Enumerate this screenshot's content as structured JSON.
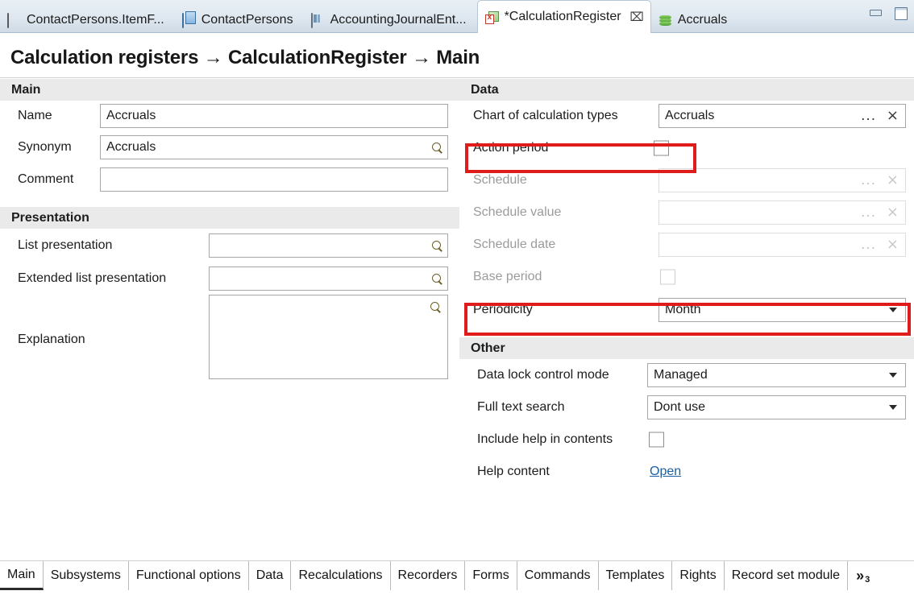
{
  "window": {
    "minimize_label": "Minimize",
    "maximize_label": "Maximize"
  },
  "editor_tabs": [
    {
      "label": "ContactPersons.ItemF...",
      "icon": "document-lines-icon",
      "active": false,
      "closable": false
    },
    {
      "label": "ContactPersons",
      "icon": "catalog-book-icon",
      "active": false,
      "closable": false
    },
    {
      "label": "AccountingJournalEnt...",
      "icon": "accounting-journal-icon",
      "active": false,
      "closable": false
    },
    {
      "label": "*CalculationRegister",
      "icon": "calculation-register-icon",
      "active": true,
      "closable": true,
      "close_glyph": "⌧"
    },
    {
      "label": "Accruals",
      "icon": "accruals-stack-icon",
      "active": false,
      "closable": false
    }
  ],
  "breadcrumb": {
    "text": "Calculation registers → CalculationRegister → Main",
    "parts": [
      "Calculation registers",
      "CalculationRegister",
      "Main"
    ],
    "separator": "→"
  },
  "left": {
    "main_section": {
      "header": "Main",
      "fields": [
        {
          "label": "Name",
          "value": "Accruals",
          "type": "text",
          "has_search": false,
          "disabled": false
        },
        {
          "label": "Synonym",
          "value": "Accruals",
          "type": "text-search",
          "has_search": true,
          "disabled": false
        },
        {
          "label": "Comment",
          "value": "",
          "type": "text",
          "has_search": false,
          "disabled": false
        }
      ]
    },
    "presentation_section": {
      "header": "Presentation",
      "fields": [
        {
          "label": "List presentation",
          "value": "",
          "type": "text-search",
          "has_search": true,
          "disabled": false
        },
        {
          "label": "Extended list presentation",
          "value": "",
          "type": "text-search",
          "has_search": true,
          "disabled": false
        },
        {
          "label": "Explanation",
          "value": "",
          "type": "textarea-search",
          "has_search": true,
          "disabled": false
        }
      ]
    }
  },
  "right": {
    "data_section": {
      "header": "Data",
      "fields": [
        {
          "label": "Chart of calculation types",
          "value": "Accruals",
          "type": "picker",
          "disabled": false,
          "ellipsis": "...",
          "clear": "×",
          "highlighted": false
        },
        {
          "label": "Action period",
          "value": "",
          "type": "checkbox",
          "checked": false,
          "disabled": false,
          "highlighted": true
        },
        {
          "label": "Schedule",
          "value": "",
          "type": "picker",
          "disabled": true,
          "ellipsis": "...",
          "clear": "×",
          "highlighted": false
        },
        {
          "label": "Schedule value",
          "value": "",
          "type": "picker",
          "disabled": true,
          "ellipsis": "...",
          "clear": "×",
          "highlighted": false
        },
        {
          "label": "Schedule date",
          "value": "",
          "type": "picker",
          "disabled": true,
          "ellipsis": "...",
          "clear": "×",
          "highlighted": false
        },
        {
          "label": "Base period",
          "value": "",
          "type": "checkbox",
          "checked": false,
          "disabled": true,
          "highlighted": false
        },
        {
          "label": "Periodicity",
          "value": "Month",
          "type": "combo",
          "disabled": false,
          "highlighted": true
        }
      ]
    },
    "other_section": {
      "header": "Other",
      "fields": [
        {
          "label": "Data lock control mode",
          "value": "Managed",
          "type": "combo",
          "disabled": false
        },
        {
          "label": "Full text search",
          "value": "Dont use",
          "type": "combo",
          "disabled": false
        },
        {
          "label": "Include help in contents",
          "value": "",
          "type": "checkbox",
          "checked": false,
          "disabled": false
        },
        {
          "label": "Help content",
          "value": "Open",
          "type": "link",
          "disabled": false
        }
      ]
    }
  },
  "bottom_tabs": [
    {
      "label": "Main",
      "active": true
    },
    {
      "label": "Subsystems",
      "active": false
    },
    {
      "label": "Functional options",
      "active": false
    },
    {
      "label": "Data",
      "active": false
    },
    {
      "label": "Recalculations",
      "active": false
    },
    {
      "label": "Recorders",
      "active": false
    },
    {
      "label": "Forms",
      "active": false
    },
    {
      "label": "Commands",
      "active": false
    },
    {
      "label": "Templates",
      "active": false
    },
    {
      "label": "Rights",
      "active": false
    },
    {
      "label": "Record set module",
      "active": false
    }
  ],
  "bottom_overflow": {
    "glyph": "»",
    "count": "3"
  },
  "colors": {
    "highlight_red": "#e01b1b",
    "section_header_bg": "#eaeaea",
    "link_blue": "#1c5f9e",
    "disabled_text": "#9b9b9b",
    "active_tab_bg": "#ffffff",
    "tabstrip_bg": "#dfe8f0"
  }
}
